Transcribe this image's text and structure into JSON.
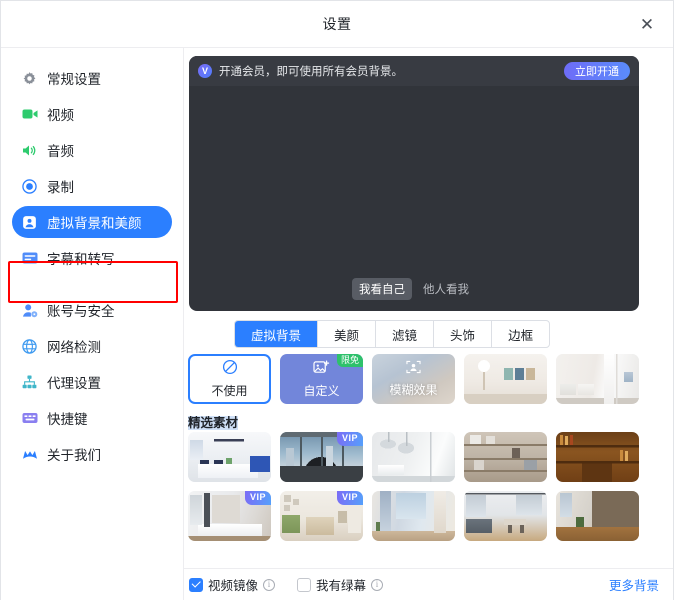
{
  "window": {
    "title": "设置",
    "close_label": "✕"
  },
  "sidebar": {
    "items": [
      {
        "label": "常规设置",
        "icon": "gear-icon",
        "active": false
      },
      {
        "label": "视频",
        "icon": "video-camera-icon",
        "active": false
      },
      {
        "label": "音频",
        "icon": "speaker-icon",
        "active": false
      },
      {
        "label": "录制",
        "icon": "record-circle-icon",
        "active": false
      },
      {
        "label": "虚拟背景和美颜",
        "icon": "person-card-icon",
        "active": true
      },
      {
        "label": "字幕和转写",
        "icon": "subtitle-icon",
        "active": false
      },
      {
        "label": "账号与安全",
        "icon": "person-lock-icon",
        "active": false
      },
      {
        "label": "网络检测",
        "icon": "globe-icon",
        "active": false
      },
      {
        "label": "代理设置",
        "icon": "sitemap-icon",
        "active": false
      },
      {
        "label": "快捷键",
        "icon": "keyboard-icon",
        "active": false
      },
      {
        "label": "关于我们",
        "icon": "brand-icon",
        "active": false
      }
    ]
  },
  "preview": {
    "banner_text": "开通会员，即可使用所有会员背景。",
    "banner_icon": "vip-crown-icon",
    "cta_label": "立即开通",
    "view_options": [
      {
        "label": "我看自己",
        "selected": true
      },
      {
        "label": "他人看我",
        "selected": false
      }
    ]
  },
  "tabs": [
    {
      "label": "虚拟背景",
      "active": true
    },
    {
      "label": "美颜",
      "active": false
    },
    {
      "label": "滤镜",
      "active": false
    },
    {
      "label": "头饰",
      "active": false
    },
    {
      "label": "边框",
      "active": false
    }
  ],
  "quick_row": {
    "none": {
      "label": "不使用",
      "icon": "no-entry-icon",
      "selected": true
    },
    "custom": {
      "label": "自定义",
      "icon": "image-plus-icon",
      "badge": "限免"
    },
    "blur": {
      "label": "模糊效果",
      "icon": "person-frame-icon"
    },
    "thumbs": [
      {
        "name": "living-room-art-wall",
        "badge": ""
      },
      {
        "name": "bedroom-white-curtain",
        "badge": ""
      }
    ]
  },
  "featured": {
    "title": "精选素材",
    "rows": [
      [
        {
          "name": "meeting-room-blue-sofa",
          "badge": ""
        },
        {
          "name": "office-city-window-chair",
          "badge": "VIP"
        },
        {
          "name": "white-studio-pendant-lamps",
          "badge": ""
        },
        {
          "name": "wooden-shelf-study",
          "badge": ""
        },
        {
          "name": "classic-wood-library",
          "badge": ""
        }
      ],
      [
        {
          "name": "modern-white-meeting-table",
          "badge": "VIP"
        },
        {
          "name": "green-sofa-living-room",
          "badge": "VIP"
        },
        {
          "name": "curtain-window-plant",
          "badge": ""
        },
        {
          "name": "loft-lounge-dining",
          "badge": ""
        },
        {
          "name": "cafe-counter-bookshelf",
          "badge": ""
        }
      ]
    ]
  },
  "bottom": {
    "mirror": {
      "label": "视频镜像",
      "checked": true,
      "info_icon": "info-icon"
    },
    "greenscreen": {
      "label": "我有绿幕",
      "checked": false,
      "info_icon": "info-icon"
    },
    "more_link": "更多背景"
  },
  "colors": {
    "accent": "#2b7fff",
    "annotation": "#ff0000",
    "vip_badge": "#7b6cf6",
    "free_badge": "#2ec16b",
    "preview_bg": "#31343a"
  }
}
